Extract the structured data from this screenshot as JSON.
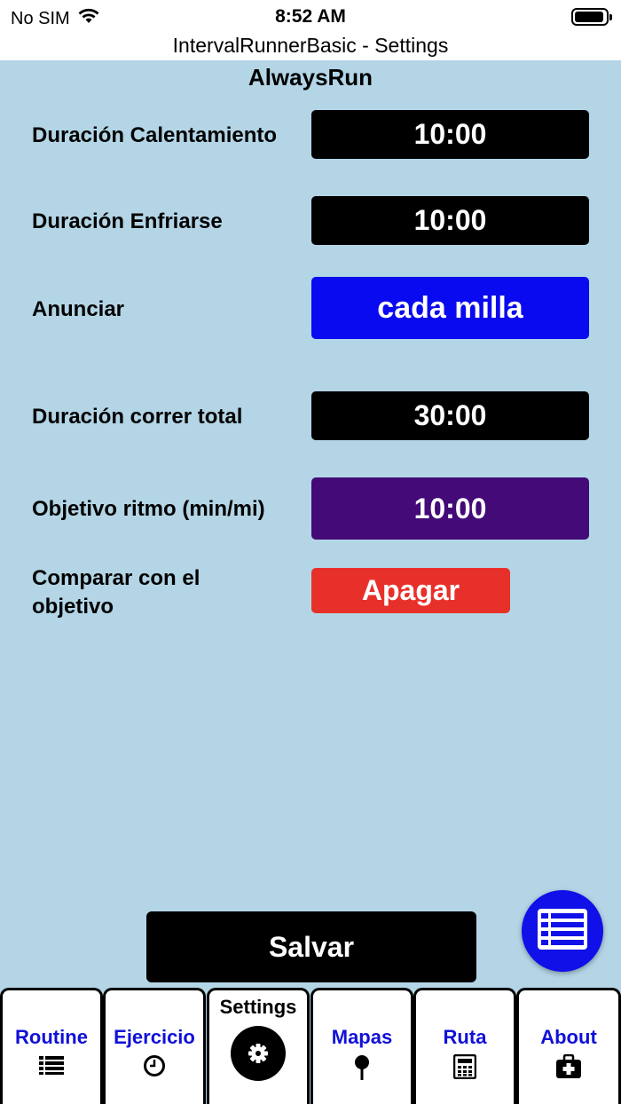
{
  "status_bar": {
    "carrier": "No SIM",
    "time": "8:52 AM",
    "battery_level": 0.95
  },
  "nav": {
    "title": "IntervalRunnerBasic - Settings"
  },
  "app": {
    "name": "AlwaysRun"
  },
  "settings": [
    {
      "label": "Duración Calentamiento",
      "value": "10:00",
      "color": "#000000"
    },
    {
      "label": "Duración Enfriarse",
      "value": "10:00",
      "color": "#000000"
    },
    {
      "label": "Anunciar",
      "value": "cada milla",
      "color": "#0a0af0"
    },
    {
      "label": "Duración correr total",
      "value": "30:00",
      "color": "#000000"
    },
    {
      "label": "Objetivo ritmo (min/mi)",
      "value": "10:00",
      "color": "#430a78"
    },
    {
      "label": "Comparar con el objetivo",
      "value": "Apagar",
      "color": "#e8302a"
    }
  ],
  "save_button": {
    "label": "Salvar"
  },
  "fab": {
    "icon": "list-icon",
    "color": "#1010e8"
  },
  "tabs": [
    {
      "label": "Routine",
      "icon": "list-icon"
    },
    {
      "label": "Ejercicio",
      "icon": "clock-icon"
    },
    {
      "label": "Settings",
      "icon": "gear-icon",
      "active": true
    },
    {
      "label": "Mapas",
      "icon": "map-pin-icon"
    },
    {
      "label": "Ruta",
      "icon": "calculator-icon"
    },
    {
      "label": "About",
      "icon": "first-aid-kit-icon"
    }
  ]
}
